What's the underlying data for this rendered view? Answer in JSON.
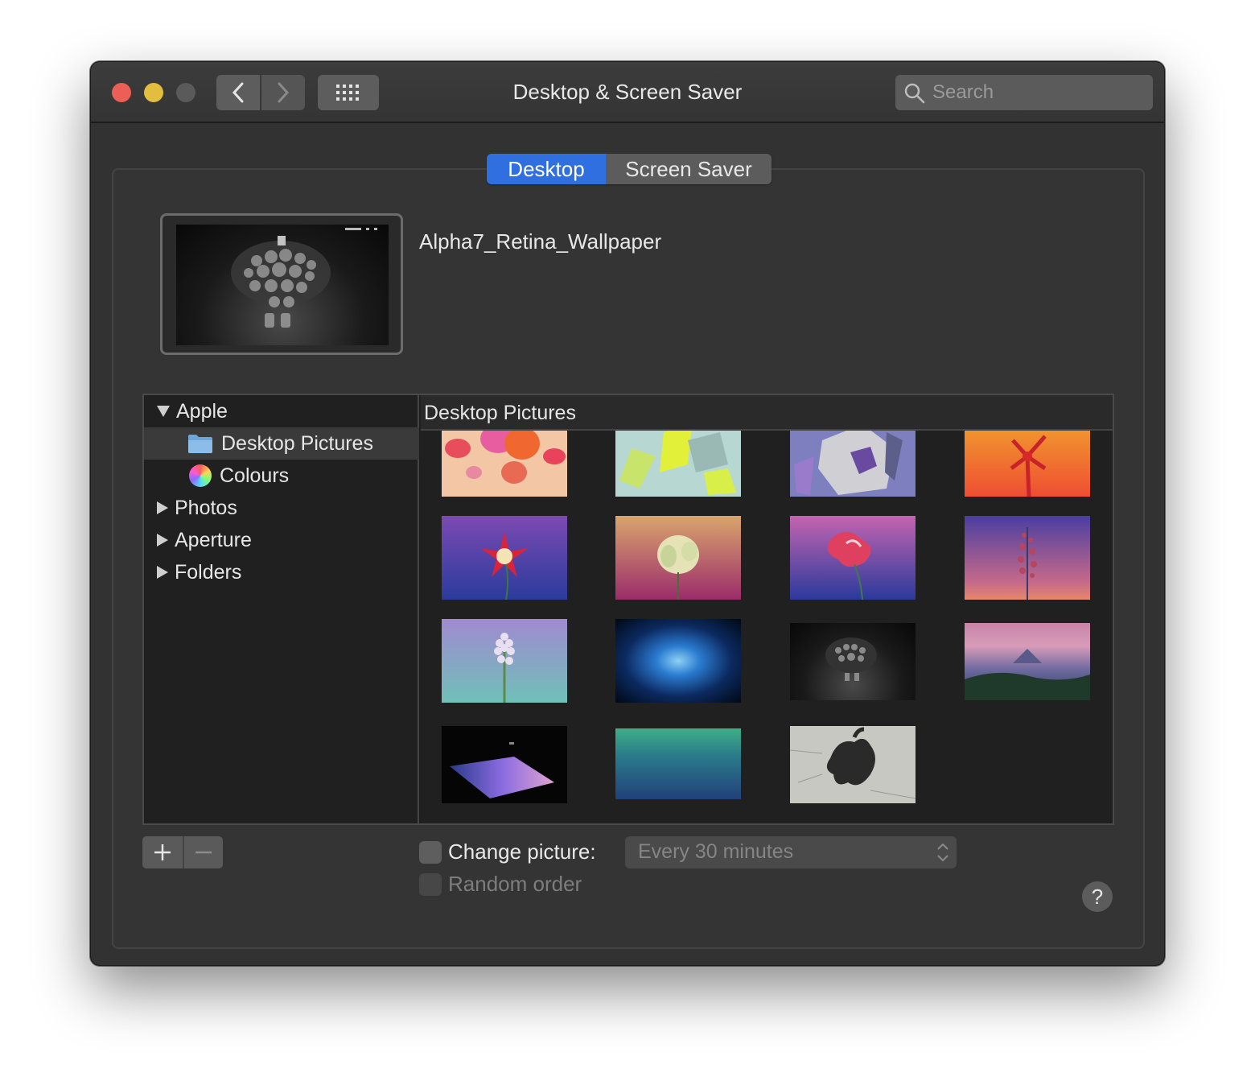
{
  "window": {
    "title": "Desktop & Screen Saver",
    "search_placeholder": "Search"
  },
  "tabs": [
    {
      "label": "Desktop",
      "selected": true
    },
    {
      "label": "Screen Saver",
      "selected": false
    }
  ],
  "current_wallpaper": {
    "name": "Alpha7_Retina_Wallpaper"
  },
  "sidebar": {
    "items": [
      {
        "label": "Apple",
        "expanded": true,
        "level": 0
      },
      {
        "label": "Desktop Pictures",
        "icon": "folder-icon",
        "selected": true,
        "level": 1
      },
      {
        "label": "Colours",
        "icon": "color-wheel-icon",
        "level": 1
      },
      {
        "label": "Photos",
        "expanded": false,
        "level": 0
      },
      {
        "label": "Aperture",
        "expanded": false,
        "level": 0
      },
      {
        "label": "Folders",
        "expanded": false,
        "level": 0
      }
    ]
  },
  "content": {
    "header": "Desktop Pictures"
  },
  "controls": {
    "change_picture_label": "Change picture:",
    "change_picture_checked": false,
    "interval_value": "Every 30 minutes",
    "random_order_label": "Random order",
    "random_order_checked": false,
    "help_label": "?"
  },
  "colors": {
    "accent": "#2f6fe0",
    "window_bg": "#323232",
    "close": "#ec5f57",
    "minimize": "#e1be3e"
  }
}
